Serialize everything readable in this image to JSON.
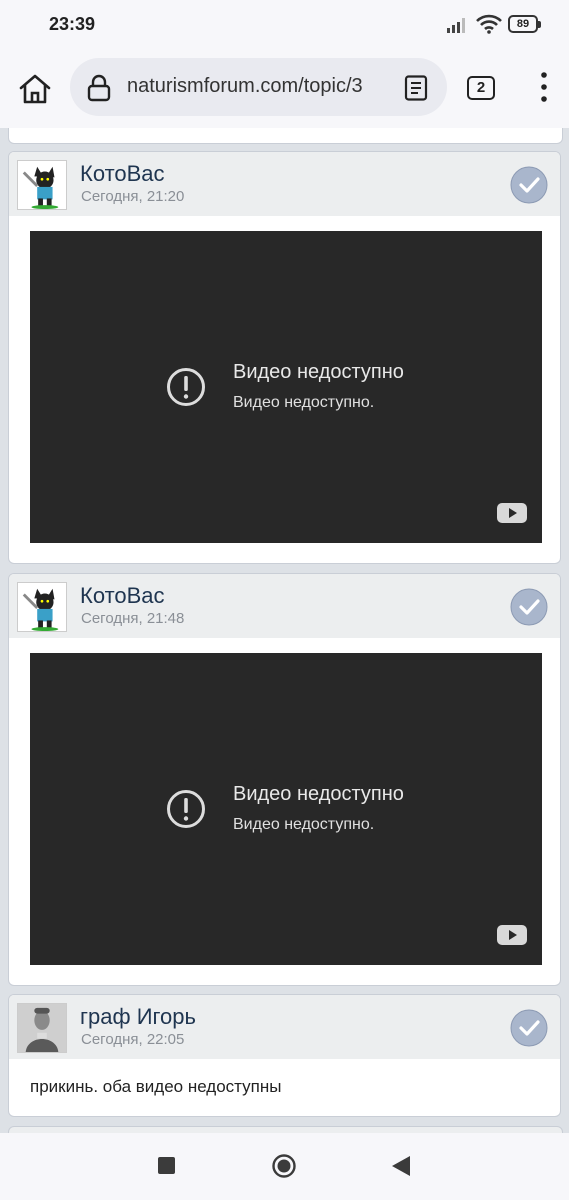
{
  "status": {
    "time": "23:39",
    "battery": "89"
  },
  "browser": {
    "url": "naturismforum.com/topic/3",
    "tabs_count": "2"
  },
  "posts": [
    {
      "author": "КотоВас",
      "time": "Сегодня, 21:20",
      "avatar": "cat-avatar",
      "video": {
        "title": "Видео недоступно",
        "subtitle": "Видео недоступно."
      }
    },
    {
      "author": "КотоВас",
      "time": "Сегодня, 21:48",
      "avatar": "cat-avatar",
      "video": {
        "title": "Видео недоступно",
        "subtitle": "Видео недоступно."
      }
    },
    {
      "author": "граф Игорь",
      "time": "Сегодня, 22:05",
      "avatar": "portrait-avatar",
      "text": "прикинь. оба видео недоступны"
    }
  ],
  "colors": {
    "author": "#1f3550",
    "header_bg": "#eceeef",
    "video_bg": "#282828",
    "page_bg": "#dde1e6"
  }
}
